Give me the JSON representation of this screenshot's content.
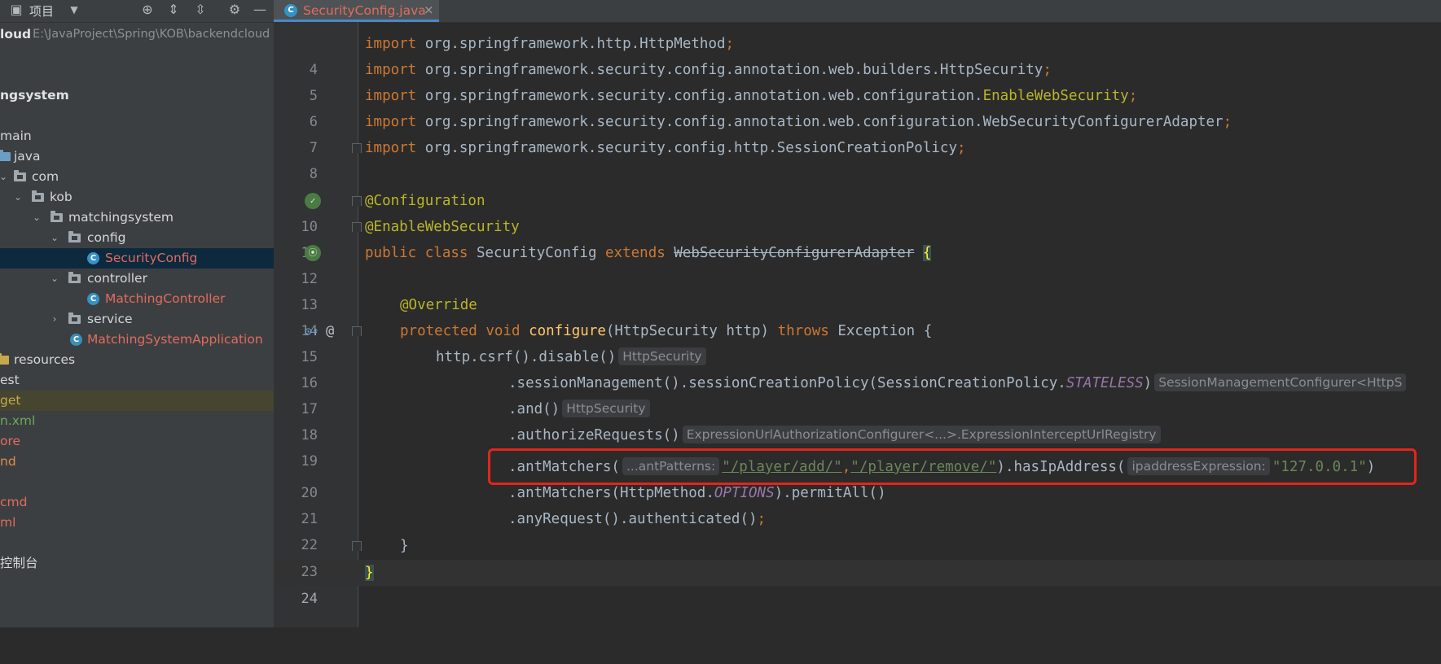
{
  "project_panel": {
    "title": "项目",
    "root_label": "loud",
    "root_path": "E:\\JavaProject\\Spring\\KOB\\backendcloud",
    "module_label": "ngsystem",
    "tree": {
      "main": "main",
      "java": "java",
      "com": "com",
      "kob": "kob",
      "matchingsystem": "matchingsystem",
      "config": "config",
      "security_config": "SecurityConfig",
      "controller": "controller",
      "matching_controller": "MatchingController",
      "service": "service",
      "matching_app": "MatchingSystemApplication",
      "resources": "resources",
      "test": "est",
      "target": "get",
      "pom": "n.xml",
      "ignore": "ore",
      "md": "nd",
      "cmd": "cmd",
      "iml": "ml",
      "console": "控制台"
    }
  },
  "editor": {
    "tab": {
      "label": "SecurityConfig.java",
      "close": "×"
    },
    "lines": {
      "l4": {
        "num": "4",
        "kw": "import",
        "text": " org.springframework.http.HttpMethod",
        "semi": ";"
      },
      "l5": {
        "num": "5",
        "kw": "import",
        "text": " org.springframework.security.config.annotation.web.builders.HttpSecurity",
        "semi": ";"
      },
      "l6": {
        "num": "6",
        "kw": "import",
        "text": " org.springframework.security.config.annotation.web.configuration.",
        "ann": "EnableWebSecurity",
        "semi": ";"
      },
      "l7": {
        "num": "7",
        "kw": "import",
        "text": " org.springframework.security.config.annotation.web.configuration.WebSecurityConfigurerAdapter",
        "semi": ";"
      },
      "l8": {
        "num": "8",
        "kw": "import",
        "text": " org.springframework.security.config.http.SessionCreationPolicy",
        "semi": ";"
      },
      "l9": {
        "num": "9"
      },
      "l10": {
        "num": "10",
        "ann": "@Configuration"
      },
      "l11": {
        "num": "11",
        "ann": "@EnableWebSecurity"
      },
      "l12": {
        "num": "12",
        "kw1": "public class",
        "name": " SecurityConfig ",
        "kw2": "extends",
        "parent": "WebSecurityConfigurerAdapter",
        "brace": "{"
      },
      "l13": {
        "num": "13"
      },
      "l14": {
        "num": "14",
        "ann": "@Override"
      },
      "l15": {
        "num": "15",
        "kw1": "protected void",
        "fn": "configure",
        "params": "(HttpSecurity http) ",
        "kw2": "throws",
        "rest": " Exception {"
      },
      "l16": {
        "num": "16",
        "text": "http.csrf().disable()",
        "hint": "HttpSecurity"
      },
      "l17": {
        "num": "17",
        "text": ".sessionManagement().sessionCreationPolicy(SessionCreationPolicy.",
        "const": "STATELESS",
        "close": ")",
        "hint": "SessionManagementConfigurer<HttpS"
      },
      "l18": {
        "num": "18",
        "text": ".and()",
        "hint": "HttpSecurity"
      },
      "l19": {
        "num": "19",
        "text": ".authorizeRequests()",
        "hint": "ExpressionUrlAuthorizationConfigurer<...>.ExpressionInterceptUrlRegistry"
      },
      "l20": {
        "num": "20",
        "text1": ".antMatchers(",
        "hint1": "...antPatterns:",
        "str1": "\"/player/add/\"",
        "comma": ",",
        "str2": "\"/player/remove/\"",
        "text2": ").hasIpAddress(",
        "hint2": "ipaddressExpression:",
        "str3": "\"127.0.0.1\"",
        "close": ")"
      },
      "l21": {
        "num": "21",
        "text1": ".antMatchers(HttpMethod.",
        "const": "OPTIONS",
        "text2": ").permitAll()"
      },
      "l22": {
        "num": "22",
        "text": ".anyRequest().authenticated()",
        "semi": ";"
      },
      "l23": {
        "num": "23",
        "text": "}"
      },
      "l24": {
        "num": "24",
        "text": "}"
      }
    }
  },
  "colors": {
    "highlight_box": "#e5241a",
    "keyword": "#cc7832",
    "annotation": "#bbb529",
    "string": "#6a8759"
  }
}
